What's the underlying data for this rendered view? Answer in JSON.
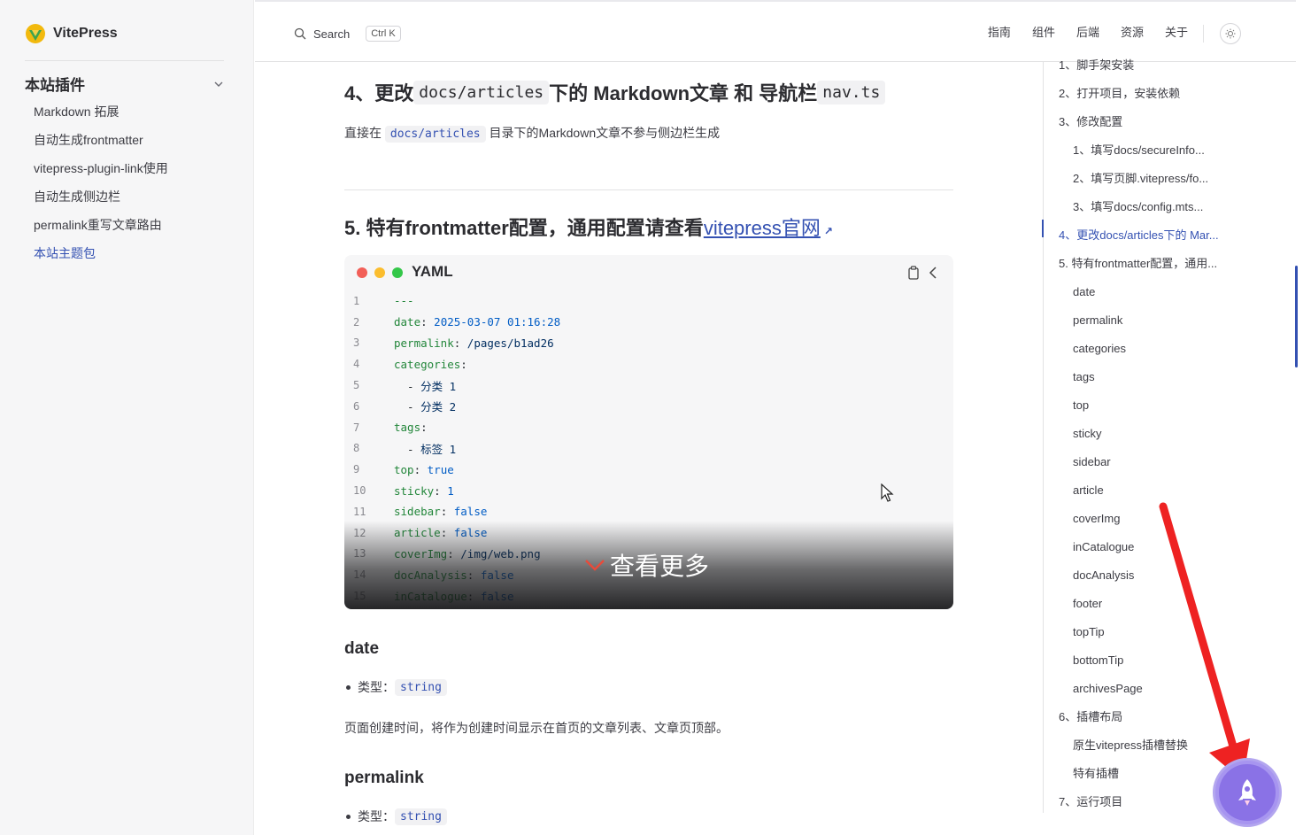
{
  "app": {
    "name": "VitePress"
  },
  "sidebar": {
    "group_title": "本站插件",
    "items": [
      {
        "label": "Markdown 拓展",
        "active": false
      },
      {
        "label": "自动生成frontmatter",
        "active": false
      },
      {
        "label": "vitepress-plugin-link使用",
        "active": false
      },
      {
        "label": "自动生成侧边栏",
        "active": false
      },
      {
        "label": "permalink重写文章路由",
        "active": false
      },
      {
        "label": "本站主题包",
        "active": true
      }
    ]
  },
  "topnav": {
    "search_label": "Search",
    "search_shortcut": "Ctrl K",
    "links": [
      "指南",
      "组件",
      "后端",
      "资源",
      "关于"
    ]
  },
  "content": {
    "section4": {
      "title_prefix": "4、更改",
      "title_code1": "docs/articles",
      "title_mid": "下的 Markdown文章 和 导航栏",
      "title_code2": "nav.ts",
      "para_prefix": "直接在",
      "para_code": "docs/articles",
      "para_suffix": "目录下的Markdown文章不参与侧边栏生成"
    },
    "section5": {
      "title_prefix": "5. 特有frontmatter配置，通用配置请查看",
      "title_link": "vitepress官网",
      "ext_icon": "↗"
    },
    "codeblock": {
      "lang": "YAML",
      "more_label": "查看更多",
      "lines": [
        {
          "n": "1",
          "key": "---",
          "val": ""
        },
        {
          "n": "2",
          "key": "date",
          "val": "2025-03-07 01:16:28"
        },
        {
          "n": "3",
          "key": "permalink",
          "val": "/pages/b1ad26"
        },
        {
          "n": "4",
          "key": "categories",
          "val": ""
        },
        {
          "n": "5",
          "key": "  - ",
          "val": "分类 1"
        },
        {
          "n": "6",
          "key": "  - ",
          "val": "分类 2"
        },
        {
          "n": "7",
          "key": "tags",
          "val": ""
        },
        {
          "n": "8",
          "key": "  - ",
          "val": "标签 1"
        },
        {
          "n": "9",
          "key": "top",
          "val": "true"
        },
        {
          "n": "10",
          "key": "sticky",
          "val": "1"
        },
        {
          "n": "11",
          "key": "sidebar",
          "val": "false"
        },
        {
          "n": "12",
          "key": "article",
          "val": "false"
        },
        {
          "n": "13",
          "key": "coverImg",
          "val": "/img/web.png"
        },
        {
          "n": "14",
          "key": "docAnalysis",
          "val": "false"
        },
        {
          "n": "15",
          "key": "inCatalogue",
          "val": "false"
        }
      ]
    },
    "date": {
      "title": "date",
      "type_label": "类型：",
      "type_value": "string",
      "desc": "页面创建时间，将作为创建时间显示在首页的文章列表、文章页顶部。"
    },
    "permalink": {
      "title": "permalink",
      "type_label": "类型：",
      "type_value": "string"
    }
  },
  "toc": {
    "items": [
      {
        "label": "1、脚手架安装",
        "level": 1,
        "active": false
      },
      {
        "label": "2、打开项目，安装依赖",
        "level": 1,
        "active": false
      },
      {
        "label": "3、修改配置",
        "level": 1,
        "active": false
      },
      {
        "label": "1、填写docs/secureInfo...",
        "level": 2,
        "active": false
      },
      {
        "label": "2、填写页脚.vitepress/fo...",
        "level": 2,
        "active": false
      },
      {
        "label": "3、填写docs/config.mts...",
        "level": 2,
        "active": false
      },
      {
        "label": "4、更改docs/articles下的 Mar...",
        "level": 1,
        "active": true
      },
      {
        "label": "5. 特有frontmatter配置，通用...",
        "level": 1,
        "active": false
      },
      {
        "label": "date",
        "level": 2,
        "active": false
      },
      {
        "label": "permalink",
        "level": 2,
        "active": false
      },
      {
        "label": "categories",
        "level": 2,
        "active": false
      },
      {
        "label": "tags",
        "level": 2,
        "active": false
      },
      {
        "label": "top",
        "level": 2,
        "active": false
      },
      {
        "label": "sticky",
        "level": 2,
        "active": false
      },
      {
        "label": "sidebar",
        "level": 2,
        "active": false
      },
      {
        "label": "article",
        "level": 2,
        "active": false
      },
      {
        "label": "coverImg",
        "level": 2,
        "active": false
      },
      {
        "label": "inCatalogue",
        "level": 2,
        "active": false
      },
      {
        "label": "docAnalysis",
        "level": 2,
        "active": false
      },
      {
        "label": "footer",
        "level": 2,
        "active": false
      },
      {
        "label": "topTip",
        "level": 2,
        "active": false
      },
      {
        "label": "bottomTip",
        "level": 2,
        "active": false
      },
      {
        "label": "archivesPage",
        "level": 2,
        "active": false
      },
      {
        "label": "6、插槽布局",
        "level": 1,
        "active": false
      },
      {
        "label": "原生vitepress插槽替换",
        "level": 2,
        "active": false
      },
      {
        "label": "特有插槽",
        "level": 2,
        "active": false
      },
      {
        "label": "7、运行项目",
        "level": 1,
        "active": false
      }
    ]
  },
  "colors": {
    "brand": "#3451b2",
    "annotation_arrow": "#ee2222",
    "rocket": "#8a72e6"
  },
  "icons": {
    "search": "search-icon",
    "theme": "sun-icon",
    "rocket": "rocket-icon",
    "copy": "copy-icon",
    "fold": "chevron-left-icon",
    "more": "chevron-down-icon"
  }
}
